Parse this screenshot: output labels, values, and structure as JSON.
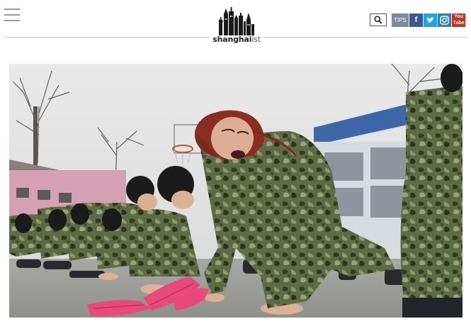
{
  "header": {
    "logo_text_main": "shanghai",
    "logo_text_suffix": "ist",
    "tips_label": "TIPS",
    "facebook_label": "f",
    "twitter_label": "t",
    "instagram_label": "ig",
    "youtube_label": "You Tube"
  },
  "colors": {
    "facebook": "#3b5998",
    "twitter": "#1da1f2",
    "instagram": "#2a7fbd",
    "youtube": "#d52b1e",
    "tips": "#7d8a99"
  },
  "icons": {
    "menu": "hamburger-icon",
    "search": "search-icon",
    "logo": "skyline-logo-icon"
  }
}
